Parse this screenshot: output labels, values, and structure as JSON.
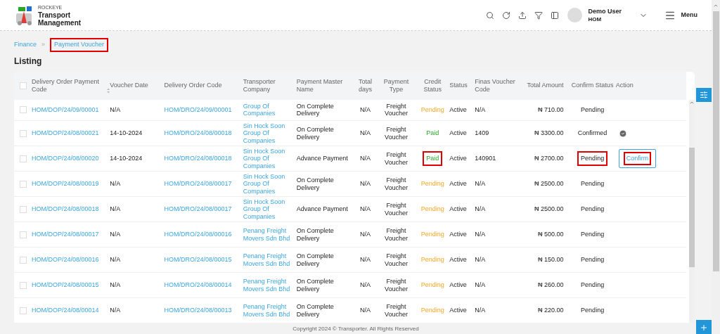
{
  "header": {
    "brand_small": "ROCKEYE",
    "brand_line1": "Transport",
    "brand_line2": "Management",
    "user_name": "Demo User",
    "user_org": "HOM",
    "menu_label": "Menu"
  },
  "breadcrumb": [
    {
      "label": "Finance",
      "highlighted": false
    },
    {
      "label": "Payment Voucher",
      "highlighted": true
    }
  ],
  "breadcrumb_separator": "»",
  "page_title": "Listing",
  "table": {
    "columns": [
      "Delivery Order Payment Code",
      "Voucher Date",
      "Delivery Order Code",
      "Transporter Company",
      "Payment Master Name",
      "Total days",
      "Payment Type",
      "Credit Status",
      "Status",
      "Finas Voucher Code",
      "Total Amount",
      "Confirm Status",
      "Action"
    ],
    "select_all_checked": false,
    "rows": [
      {
        "checked": false,
        "code": "HOM/DOP/24/09/00001",
        "voucher_date": "N/A",
        "do_code": "HOM/DRO/24/09/00001",
        "company": "Group Of Companies",
        "payment_master": "On Complete Delivery",
        "total_days": "N/A",
        "payment_type": "Freight Voucher",
        "credit_status": {
          "text": "Pending",
          "kind": "pending",
          "highlighted": false
        },
        "status": "Active",
        "finas_code": "N/A",
        "amount": "₦ 710.00",
        "confirm_status": {
          "text": "Pending",
          "highlighted": false
        },
        "action": {
          "kind": "none"
        }
      },
      {
        "checked": false,
        "code": "HOM/DOP/24/08/00021",
        "voucher_date": "14-10-2024",
        "do_code": "HOM/DRO/24/08/00018",
        "company": "Sin Hock Soon Group Of Companies",
        "payment_master": "On Complete Delivery",
        "total_days": "N/A",
        "payment_type": "Freight Voucher",
        "credit_status": {
          "text": "Paid",
          "kind": "paid",
          "highlighted": false
        },
        "status": "Active",
        "finas_code": "1409",
        "amount": "₦ 3300.00",
        "confirm_status": {
          "text": "Confirmed",
          "highlighted": false
        },
        "action": {
          "kind": "check"
        }
      },
      {
        "checked": false,
        "code": "HOM/DOP/24/08/00020",
        "voucher_date": "14-10-2024",
        "do_code": "HOM/DRO/24/08/00018",
        "company": "Sin Hock Soon Group Of Companies",
        "payment_master": "Advance Payment",
        "total_days": "N/A",
        "payment_type": "Freight Voucher",
        "credit_status": {
          "text": "Paid",
          "kind": "paid",
          "highlighted": true
        },
        "status": "Active",
        "finas_code": "140901",
        "amount": "₦ 2700.00",
        "confirm_status": {
          "text": "Pending",
          "highlighted": true
        },
        "action": {
          "kind": "button",
          "label": "Confirm",
          "highlighted": true
        }
      },
      {
        "checked": false,
        "code": "HOM/DOP/24/08/00019",
        "voucher_date": "N/A",
        "do_code": "HOM/DRO/24/08/00017",
        "company": "Sin Hock Soon Group Of Companies",
        "payment_master": "On Complete Delivery",
        "total_days": "N/A",
        "payment_type": "Freight Voucher",
        "credit_status": {
          "text": "Pending",
          "kind": "pending",
          "highlighted": false
        },
        "status": "Active",
        "finas_code": "N/A",
        "amount": "₦ 2500.00",
        "confirm_status": {
          "text": "Pending",
          "highlighted": false
        },
        "action": {
          "kind": "none"
        }
      },
      {
        "checked": false,
        "code": "HOM/DOP/24/08/00018",
        "voucher_date": "N/A",
        "do_code": "HOM/DRO/24/08/00017",
        "company": "Sin Hock Soon Group Of Companies",
        "payment_master": "Advance Payment",
        "total_days": "N/A",
        "payment_type": "Freight Voucher",
        "credit_status": {
          "text": "Pending",
          "kind": "pending",
          "highlighted": false
        },
        "status": "Active",
        "finas_code": "N/A",
        "amount": "₦ 2500.00",
        "confirm_status": {
          "text": "Pending",
          "highlighted": false
        },
        "action": {
          "kind": "none"
        }
      },
      {
        "checked": false,
        "code": "HOM/DOP/24/08/00017",
        "voucher_date": "N/A",
        "do_code": "HOM/DRO/24/08/00016",
        "company": "Penang Freight Movers Sdn Bhd",
        "payment_master": "On Complete Delivery",
        "total_days": "N/A",
        "payment_type": "Freight Voucher",
        "credit_status": {
          "text": "Pending",
          "kind": "pending",
          "highlighted": false
        },
        "status": "Active",
        "finas_code": "N/A",
        "amount": "₦ 500.00",
        "confirm_status": {
          "text": "Pending",
          "highlighted": false
        },
        "action": {
          "kind": "none"
        }
      },
      {
        "checked": false,
        "code": "HOM/DOP/24/08/00016",
        "voucher_date": "N/A",
        "do_code": "HOM/DRO/24/08/00015",
        "company": "Penang Freight Movers Sdn Bhd",
        "payment_master": "On Complete Delivery",
        "total_days": "N/A",
        "payment_type": "Freight Voucher",
        "credit_status": {
          "text": "Pending",
          "kind": "pending",
          "highlighted": false
        },
        "status": "Active",
        "finas_code": "N/A",
        "amount": "₦ 150.00",
        "confirm_status": {
          "text": "Pending",
          "highlighted": false
        },
        "action": {
          "kind": "none"
        }
      },
      {
        "checked": false,
        "code": "HOM/DOP/24/08/00015",
        "voucher_date": "N/A",
        "do_code": "HOM/DRO/24/08/00014",
        "company": "Penang Freight Movers Sdn Bhd",
        "payment_master": "On Complete Delivery",
        "total_days": "N/A",
        "payment_type": "Freight Voucher",
        "credit_status": {
          "text": "Pending",
          "kind": "pending",
          "highlighted": false
        },
        "status": "Active",
        "finas_code": "N/A",
        "amount": "₦ 260.00",
        "confirm_status": {
          "text": "Pending",
          "highlighted": false
        },
        "action": {
          "kind": "none"
        }
      },
      {
        "checked": false,
        "code": "HOM/DOP/24/08/00014",
        "voucher_date": "N/A",
        "do_code": "HOM/DRO/24/08/00013",
        "company": "Penang Freight Movers Sdn Bhd",
        "payment_master": "On Complete Delivery",
        "total_days": "N/A",
        "payment_type": "Freight Voucher",
        "credit_status": {
          "text": "Pending",
          "kind": "pending",
          "highlighted": false
        },
        "status": "Active",
        "finas_code": "N/A",
        "amount": "₦ 220.00",
        "confirm_status": {
          "text": "Pending",
          "highlighted": false
        },
        "action": {
          "kind": "none"
        }
      }
    ]
  },
  "footer": "Copyright 2024 © Transporter. All Rights Reserved"
}
